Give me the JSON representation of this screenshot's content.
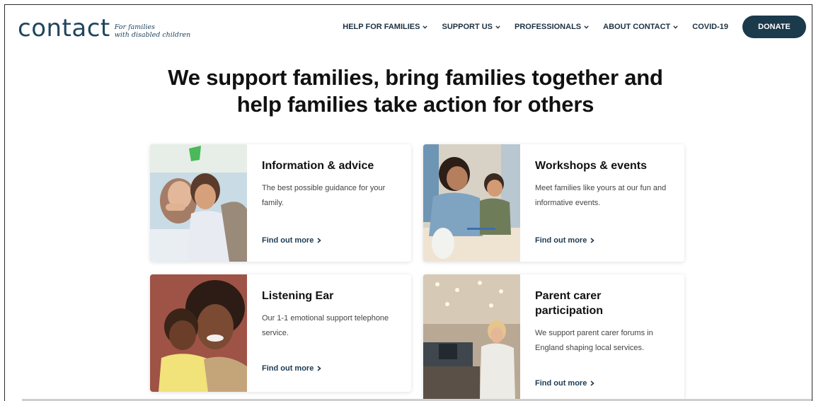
{
  "brand": {
    "logo_word": "contact",
    "tagline_line1": "For families",
    "tagline_line2": "with disabled children"
  },
  "nav": {
    "items": [
      {
        "label": "HELP FOR FAMILIES",
        "dropdown": true
      },
      {
        "label": "SUPPORT US",
        "dropdown": true
      },
      {
        "label": "PROFESSIONALS",
        "dropdown": true
      },
      {
        "label": "ABOUT CONTACT",
        "dropdown": true
      },
      {
        "label": "COVID-19",
        "dropdown": false
      }
    ],
    "donate_label": "DONATE"
  },
  "hero": {
    "line1": "We support families, bring families together and",
    "line2": "help families take action for others"
  },
  "cards": [
    {
      "title": "Information & advice",
      "desc_line1": "The best possible guidance for your",
      "desc_line2": "family.",
      "link": "Find out more",
      "image": "parent-and-child-photo"
    },
    {
      "title": "Workshops & events",
      "desc_line1": "Meet families like yours at our fun and",
      "desc_line2": "informative events.",
      "link": "Find out more",
      "image": "family-craft-activity-photo"
    },
    {
      "title": "Listening Ear",
      "desc_line1": "Our 1-1 emotional support telephone",
      "desc_line2": "service.",
      "link": "Find out more",
      "image": "mother-hugging-child-photo"
    },
    {
      "title_line1": "Parent carer",
      "title_line2": "participation",
      "desc_line1": "We support parent carer forums in",
      "desc_line2": "England shaping local services.",
      "link": "Find out more",
      "image": "speaker-at-event-photo"
    }
  ],
  "colors": {
    "brand_navy": "#1b3a4c",
    "logo_blue": "#20455e",
    "link": "#1d3a52"
  }
}
